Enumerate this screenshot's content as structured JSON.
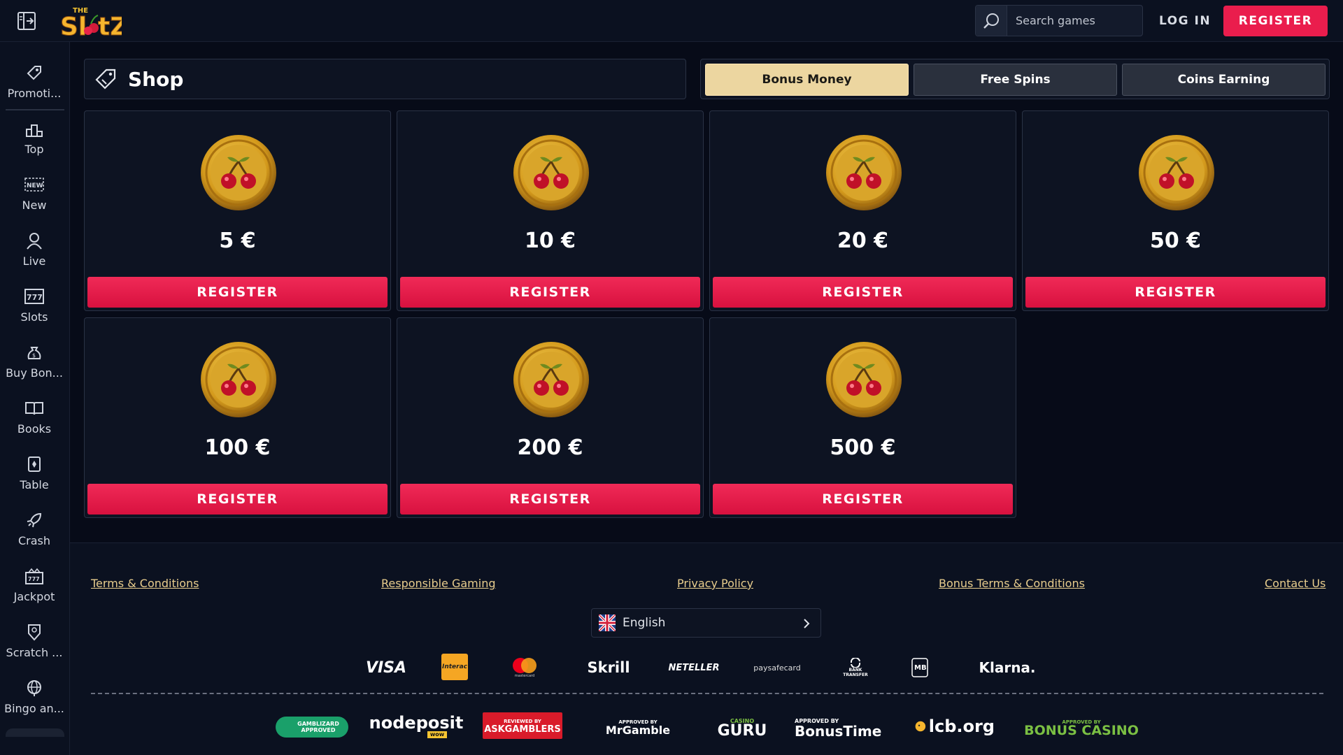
{
  "header": {
    "logo_text": "SlotZ",
    "logo_prefix": "THE",
    "search_placeholder": "Search games",
    "login_label": "LOG IN",
    "register_label": "REGISTER"
  },
  "sidebar": {
    "items": [
      {
        "label": "Promoti...",
        "icon": "tag-icon"
      },
      {
        "label": "Top",
        "icon": "podium-icon"
      },
      {
        "label": "New",
        "icon": "new-badge-icon"
      },
      {
        "label": "Live",
        "icon": "dealer-icon"
      },
      {
        "label": "Slots",
        "icon": "slot-777-icon"
      },
      {
        "label": "Buy Bon...",
        "icon": "money-bag-icon"
      },
      {
        "label": "Books",
        "icon": "book-icon"
      },
      {
        "label": "Table",
        "icon": "cards-icon"
      },
      {
        "label": "Crash",
        "icon": "rocket-icon"
      },
      {
        "label": "Jackpot",
        "icon": "jackpot-icon"
      },
      {
        "label": "Scratch ...",
        "icon": "scratch-icon"
      },
      {
        "label": "Bingo an...",
        "icon": "globe-icon"
      }
    ]
  },
  "shop": {
    "title": "Shop",
    "tabs": [
      {
        "label": "Bonus Money",
        "active": true
      },
      {
        "label": "Free Spins",
        "active": false
      },
      {
        "label": "Coins Earning",
        "active": false
      }
    ],
    "cards": [
      {
        "amount": "5 €",
        "button": "REGISTER"
      },
      {
        "amount": "10 €",
        "button": "REGISTER"
      },
      {
        "amount": "20 €",
        "button": "REGISTER"
      },
      {
        "amount": "50 €",
        "button": "REGISTER"
      },
      {
        "amount": "100 €",
        "button": "REGISTER"
      },
      {
        "amount": "200 €",
        "button": "REGISTER"
      },
      {
        "amount": "500 €",
        "button": "REGISTER"
      }
    ]
  },
  "footer": {
    "links": [
      "Terms & Conditions",
      "Responsible Gaming",
      "Privacy Policy",
      "Bonus Terms & Conditions",
      "Contact Us"
    ],
    "language": "English",
    "payments": [
      "VISA",
      "Interac",
      "mastercard",
      "Skrill",
      "NETELLER",
      "paysafecard",
      "BANK TRANSFER",
      "MB",
      "Klarna."
    ],
    "partners": [
      "GAMBLIZARD APPROVED",
      "nodeposit",
      "wow",
      "REVIEWED BY",
      "ASKGAMBLERS",
      "APPROVED BY",
      "MrGamble",
      "CASINO",
      "GURU",
      "APPROVED BY",
      "BonusTime",
      "lcb.org",
      "APPROVED BY",
      "BONUS CASINO"
    ]
  },
  "colors": {
    "accent_red": "#ea1d4d",
    "gold": "#ecd6a0",
    "link": "#e8cd8d",
    "bg": "#070b18"
  }
}
